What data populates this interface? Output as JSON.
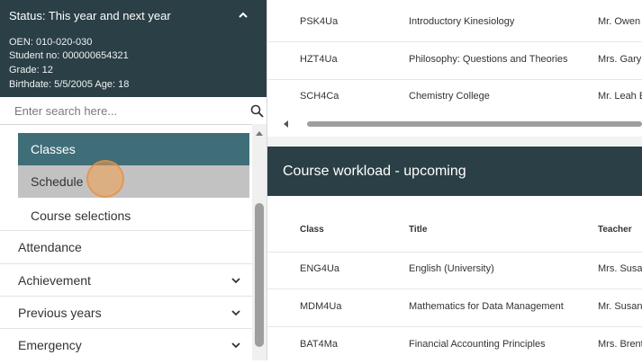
{
  "student": {
    "status": "Status: This year and next year",
    "oen": "OEN:  010-020-030",
    "student_no": "Student no:  000000654321",
    "grade": "Grade:  12",
    "birthdate": "Birthdate:  5/5/2005   Age:  18"
  },
  "search": {
    "placeholder": "Enter search here...",
    "value": ""
  },
  "nav": {
    "sub_items": [
      {
        "label": "Classes",
        "state": "active"
      },
      {
        "label": "Schedule",
        "state": "hover"
      },
      {
        "label": "Course selections",
        "state": "normal"
      }
    ],
    "main_items": [
      {
        "label": "Attendance",
        "icon": ""
      },
      {
        "label": "Achievement",
        "icon": "chevron-down-icon"
      },
      {
        "label": "Previous years",
        "icon": "chevron-down-icon"
      },
      {
        "label": "Emergency",
        "icon": "chevron-down-icon"
      }
    ]
  },
  "current_courses": {
    "rows": [
      {
        "code": "PSK4Ua",
        "title": "Introductory Kinesiology",
        "teacher": "Mr. Owen I"
      },
      {
        "code": "HZT4Ua",
        "title": "Philosophy: Questions and Theories",
        "teacher": "Mrs. Gary"
      },
      {
        "code": "SCH4Ca",
        "title": "Chemistry College",
        "teacher": "Mr. Leah E"
      }
    ]
  },
  "upcoming": {
    "title": "Course workload - upcoming",
    "columns": [
      "Class",
      "Title",
      "Teacher"
    ],
    "rows": [
      {
        "code": "ENG4Ua",
        "title": "English (University)",
        "teacher": "Mrs. Susar"
      },
      {
        "code": "MDM4Ua",
        "title": "Mathematics for Data Management",
        "teacher": "Mr. Susan"
      },
      {
        "code": "BAT4Ma",
        "title": "Financial Accounting Principles",
        "teacher": "Mrs. Brent"
      }
    ]
  },
  "colors": {
    "header_dark": "#2b3f46",
    "active_item": "#3f6e78",
    "hover_item": "#c2c2c2",
    "cursor_highlight": "#f2a050"
  }
}
